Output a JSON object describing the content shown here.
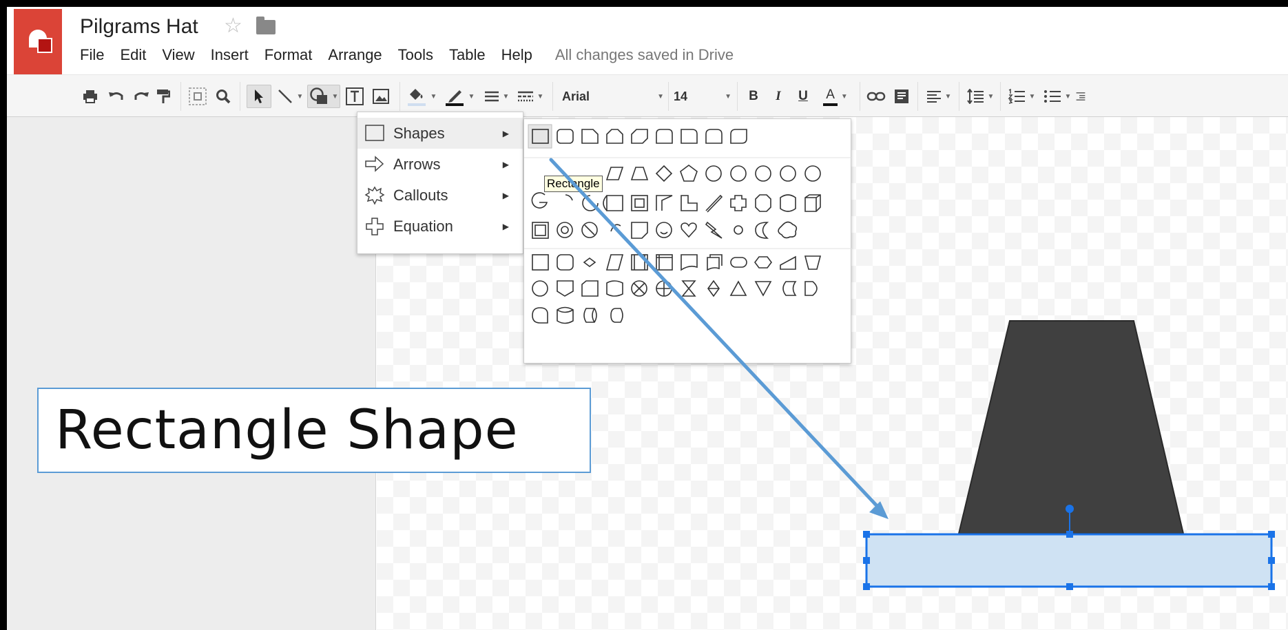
{
  "document": {
    "title": "Pilgrams Hat",
    "save_status": "All changes saved in Drive"
  },
  "menu": {
    "items": [
      "File",
      "Edit",
      "View",
      "Insert",
      "Format",
      "Arrange",
      "Tools",
      "Table",
      "Help"
    ]
  },
  "toolbar": {
    "font_family": "Arial",
    "font_size": "14",
    "bold": "B",
    "italic": "I",
    "underline": "U",
    "text_color": "A"
  },
  "insert_menu": {
    "items": [
      {
        "label": "Shapes",
        "icon": "rectangle-icon"
      },
      {
        "label": "Arrows",
        "icon": "arrow-icon"
      },
      {
        "label": "Callouts",
        "icon": "callout-icon"
      },
      {
        "label": "Equation",
        "icon": "plus-icon"
      }
    ]
  },
  "shape_tooltip": "Rectangle",
  "annotation": {
    "label": "Rectangle Shape",
    "border_color": "#5b9bd5",
    "arrow_color": "#5b9bd5"
  },
  "canvas": {
    "hat_color": "#404040",
    "selected_shape_fill": "#cfe2f3",
    "selection_color": "#1a73e8"
  }
}
